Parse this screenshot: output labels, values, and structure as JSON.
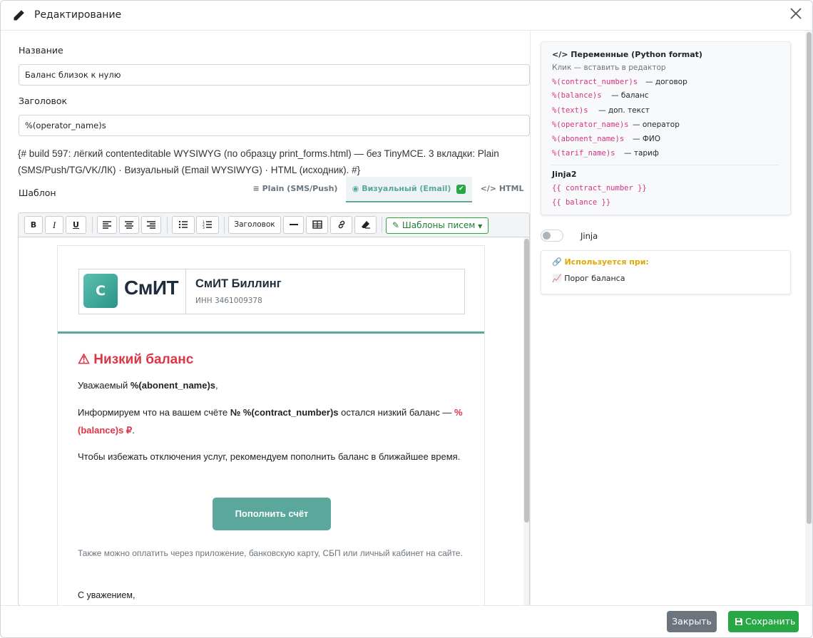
{
  "header": {
    "title": "Редактирование"
  },
  "form": {
    "name_label": "Название",
    "name_value": "Баланс близок к нулю",
    "subject_label": "Заголовок",
    "subject_value": "%(operator_name)s",
    "note": "{# build 597: лёгкий contenteditable WYSIWYG (по образцу print_forms.html) — без TinyMCE. 3 вкладки: Plain (SMS/Push/TG/VK/ЛК) · Визуальный (Email WYSIWYG) · HTML (исходник). #}",
    "template_label": "Шаблон"
  },
  "tabs": [
    {
      "label": "Plain (SMS/Push)",
      "icon": "align-left-icon"
    },
    {
      "label": "Визуальный (Email)",
      "icon": "eye-icon",
      "badge": "✔"
    },
    {
      "label": "HTML",
      "icon": "code-icon"
    }
  ],
  "toolbar": {
    "bold": "B",
    "italic": "I",
    "underline": "U",
    "heading": "Заголовок",
    "templates_button": "Шаблоны писем"
  },
  "email": {
    "logo_letter": "С",
    "logo_text": "СмИТ",
    "brand_name": "СмИТ Биллинг",
    "inn": "ИНН 3461009378",
    "heading": "⚠ Низкий баланс",
    "greeting_prefix": "Уважаемый",
    "greeting_var": "%(abonent_name)s",
    "greeting_suffix": ",",
    "info_prefix": "Информируем что на вашем счёте",
    "info_contract": "№ %(contract_number)s",
    "info_middle": "остался низкий баланс",
    "info_dash": "—",
    "info_balance": "%(balance)s ₽",
    "info_end": ".",
    "advice": "Чтобы избежать отключения услуг, рекомендуем пополнить баланс в ближайшее время.",
    "button": "Пополнить счёт",
    "small": "Также можно оплатить через приложение, банковскую карту, СБП или личный кабинет на сайте.",
    "regards": "С уважением,"
  },
  "variables": {
    "title": "Переменные (Python format)",
    "hint": "Клик — вставить в редактор",
    "items": [
      {
        "code": "%(contract_number)s",
        "desc": "— договор"
      },
      {
        "code": "%(balance)s",
        "desc": "— баланс"
      },
      {
        "code": "%(text)s",
        "desc": "— доп. текст"
      },
      {
        "code": "%(operator_name)s",
        "desc": "— оператор"
      },
      {
        "code": "%(abonent_name)s",
        "desc": "— ФИО"
      },
      {
        "code": "%(tarif_name)s",
        "desc": "— тариф"
      }
    ],
    "jinja_title": "Jinja2",
    "jinja_items": [
      "{{ contract_number }}",
      "{{ balance }}"
    ]
  },
  "jinja_toggle": {
    "label": "Jinja",
    "on": false
  },
  "used_in": {
    "title": "Используется при:",
    "item": "Порог баланса"
  },
  "footer": {
    "close": "Закрыть",
    "save": "Сохранить"
  },
  "colors": {
    "accent": "#5ba79b",
    "danger": "#dc3545",
    "success": "#28a745",
    "secondary": "#6c757d",
    "code": "#d63384",
    "warning": "#e0a800"
  }
}
